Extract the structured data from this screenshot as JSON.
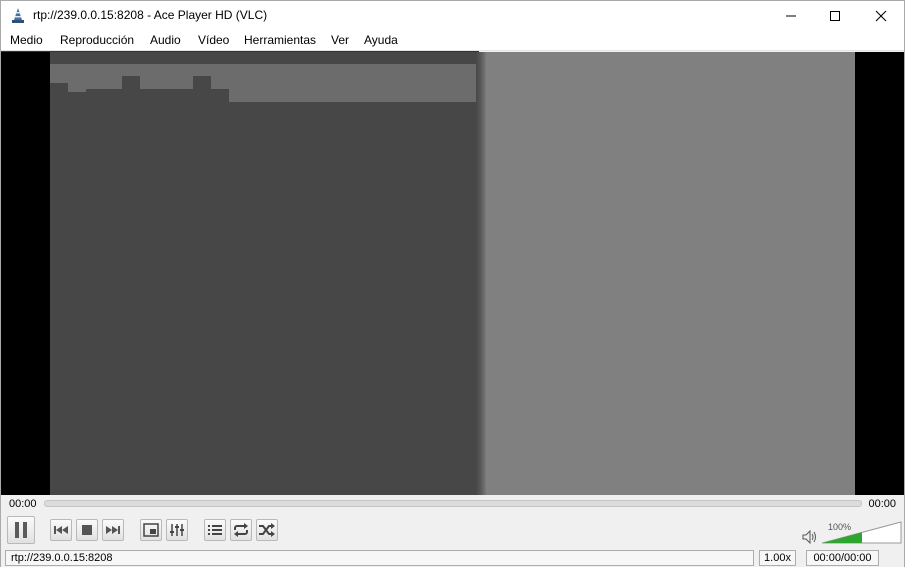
{
  "window": {
    "title": "rtp://239.0.0.15:8208 - Ace Player HD (VLC)"
  },
  "menu": {
    "items": [
      "Medio",
      "Reproducción",
      "Audio",
      "Vídeo",
      "Herramientas",
      "Ver",
      "Ayuda"
    ]
  },
  "seek": {
    "elapsed": "00:00",
    "total": "00:00",
    "position": 0
  },
  "controls": {
    "buttons": [
      "pause-icon",
      "previous-icon",
      "stop-icon",
      "next-icon",
      "fullscreen-icon",
      "extended-settings-icon",
      "playlist-icon",
      "loop-icon",
      "shuffle-icon"
    ]
  },
  "volume": {
    "label": "100%",
    "level": 1.0,
    "fill_color": "#2ea52e"
  },
  "status": {
    "url": "rtp://239.0.0.15:8208",
    "speed": "1.00x",
    "time": "00:00/00:00"
  }
}
